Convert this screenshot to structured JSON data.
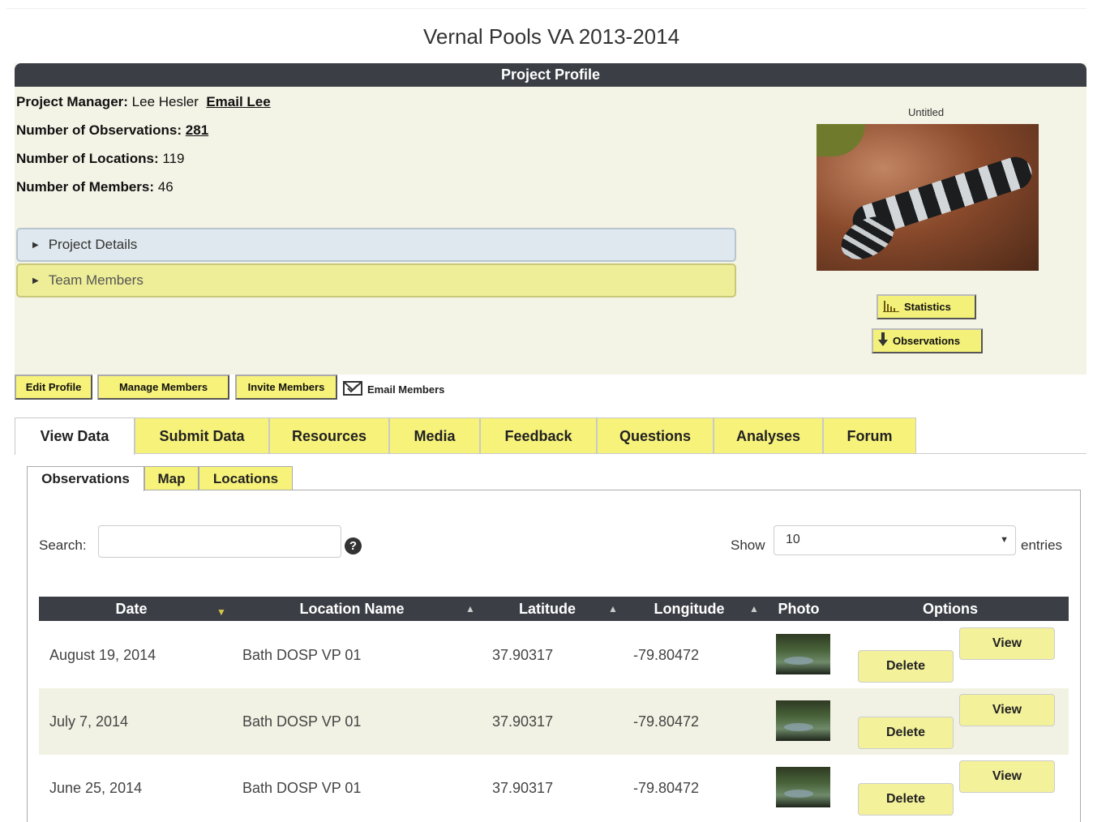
{
  "page": {
    "title": "Vernal Pools VA 2013-2014"
  },
  "profile": {
    "header": "Project Profile",
    "manager_label": "Project Manager:",
    "manager_name": "Lee Hesler",
    "email_link": "Email Lee",
    "observations_label": "Number of Observations:",
    "observations_value": "281",
    "locations_label": "Number of Locations:",
    "locations_value": "119",
    "members_label": "Number of Members:",
    "members_value": "46",
    "accordion_details": "Project Details",
    "accordion_members": "Team Members",
    "photo_caption": "Untitled",
    "statistics_button": "Statistics",
    "observations_button": "Observations"
  },
  "actions": {
    "edit_profile": "Edit Profile",
    "manage_members": "Manage Members",
    "invite_members": "Invite Members",
    "email_members": "Email Members"
  },
  "tabs": [
    "View Data",
    "Submit Data",
    "Resources",
    "Media",
    "Feedback",
    "Questions",
    "Analyses",
    "Forum"
  ],
  "subtabs": [
    "Observations",
    "Map",
    "Locations"
  ],
  "table_controls": {
    "search_label": "Search:",
    "search_value": "",
    "help_icon": "?",
    "show_label": "Show",
    "show_value": "10",
    "entries_label": "entries"
  },
  "table": {
    "columns": [
      "Date",
      "Location Name",
      "Latitude",
      "Longitude",
      "Photo",
      "Options"
    ],
    "rows": [
      {
        "date": "August 19, 2014",
        "location": "Bath DOSP VP 01",
        "latitude": "37.90317",
        "longitude": "-79.80472",
        "view": "View",
        "delete": "Delete"
      },
      {
        "date": "July 7, 2014",
        "location": "Bath DOSP VP 01",
        "latitude": "37.90317",
        "longitude": "-79.80472",
        "view": "View",
        "delete": "Delete"
      },
      {
        "date": "June 25, 2014",
        "location": "Bath DOSP VP 01",
        "latitude": "37.90317",
        "longitude": "-79.80472",
        "view": "View",
        "delete": "Delete"
      }
    ]
  },
  "colors": {
    "header_dark": "#3b3f45",
    "accent_yellow": "#f7f27a",
    "panel_bg": "#f3f3e6",
    "alt_row": "#f2f2e4"
  }
}
